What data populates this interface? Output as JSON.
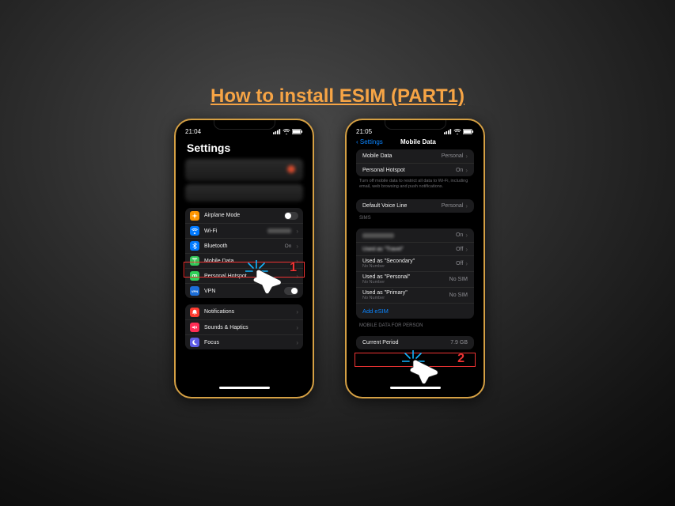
{
  "title": "How to install ESIM (PART1)",
  "phone1": {
    "time": "21:04",
    "header": "Settings",
    "rows": {
      "airplane": "Airplane Mode",
      "wifi": "Wi-Fi",
      "wifi_value": "",
      "bluetooth": "Bluetooth",
      "bluetooth_value": "On",
      "mobile_data": "Mobile Data",
      "personal_hotspot": "Personal Hotspot",
      "vpn": "VPN",
      "notifications": "Notifications",
      "sounds": "Sounds & Haptics",
      "focus": "Focus"
    },
    "step": "1"
  },
  "phone2": {
    "time": "21:05",
    "back": "Settings",
    "nav_title": "Mobile Data",
    "rows": {
      "mobile_data": "Mobile Data",
      "mobile_data_value": "Personal",
      "personal_hotspot": "Personal Hotspot",
      "personal_hotspot_value": "On",
      "footnote": "Turn off mobile data to restrict all data to Wi-Fi, including email, web browsing and push notifications.",
      "default_voice": "Default Voice Line",
      "default_voice_value": "Personal",
      "sims_header": "SIMs",
      "sim0_value": "On",
      "sim1_label": "Used as \"Travel\"",
      "sim1_value": "Off",
      "sim2_label": "Used as \"Secondary\"",
      "sim2_sub": "No Number",
      "sim2_value": "Off",
      "sim3_label": "Used as \"Personal\"",
      "sim3_sub": "No Number",
      "sim3_value": "No SIM",
      "sim4_label": "Used as \"Primary\"",
      "sim4_sub": "No Number",
      "sim4_value": "No SIM",
      "add_esim": "Add eSIM",
      "data_header": "MOBILE DATA FOR PERSON",
      "current_period": "Current Period",
      "current_period_value": "7.9 GB"
    },
    "step": "2"
  }
}
